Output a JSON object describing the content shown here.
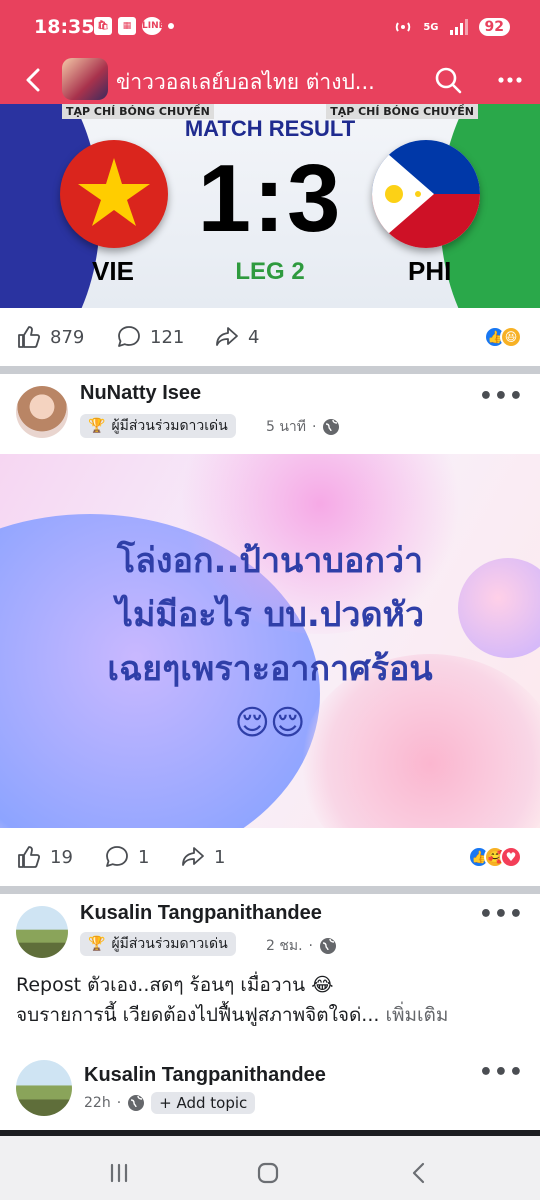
{
  "status_bar": {
    "time": "18:35",
    "network": "5G",
    "battery": "92",
    "mini_icons": [
      "shopee-icon",
      "app-icon",
      "line-icon"
    ],
    "line_label": "LINE"
  },
  "app_bar": {
    "title": "ข่าววอลเลย์บอลไทย ต่างป..."
  },
  "match_card": {
    "tag_left": "TẠP CHÍ BÓNG CHUYỀN",
    "tag_right": "TẠP CHÍ BÓNG CHUYỀN",
    "heading": "MATCH RESULT",
    "score": "1:3",
    "leg": "LEG 2",
    "team_left": "VIE",
    "team_right": "PHI",
    "likes": "879",
    "comments": "121",
    "shares": "4"
  },
  "post1": {
    "author": "NuNatty Isee",
    "badge": "ผู้มีส่วนร่วมดาวเด่น",
    "time": "5 นาที",
    "text_lines": [
      "โล่งอก..ป้านาบอกว่า",
      "ไม่มีอะไร บบ.ปวดหัว",
      "เฉยๆเพราะอากาศร้อน",
      "😌😌"
    ],
    "likes": "19",
    "comments": "1",
    "shares": "1"
  },
  "post2": {
    "author": "Kusalin Tangpanithandee",
    "badge": "ผู้มีส่วนร่วมดาวเด่น",
    "time": "2 ชม.",
    "line1": "Repost ตัวเอง..สดๆ ร้อนๆ เมื่อวาน 😂",
    "line2": "จบรายการนี้ เวียดต้องไปฟื้นฟูสภาพจิตใจด่...",
    "see_more": "เพิ่มเติม"
  },
  "post3": {
    "author": "Kusalin Tangpanithandee",
    "time": "22h",
    "add_topic": "+ Add topic"
  },
  "colors": {
    "brand": "#e8415d",
    "fb_blue": "#1877f2",
    "post_text": "#2f3fa8"
  }
}
